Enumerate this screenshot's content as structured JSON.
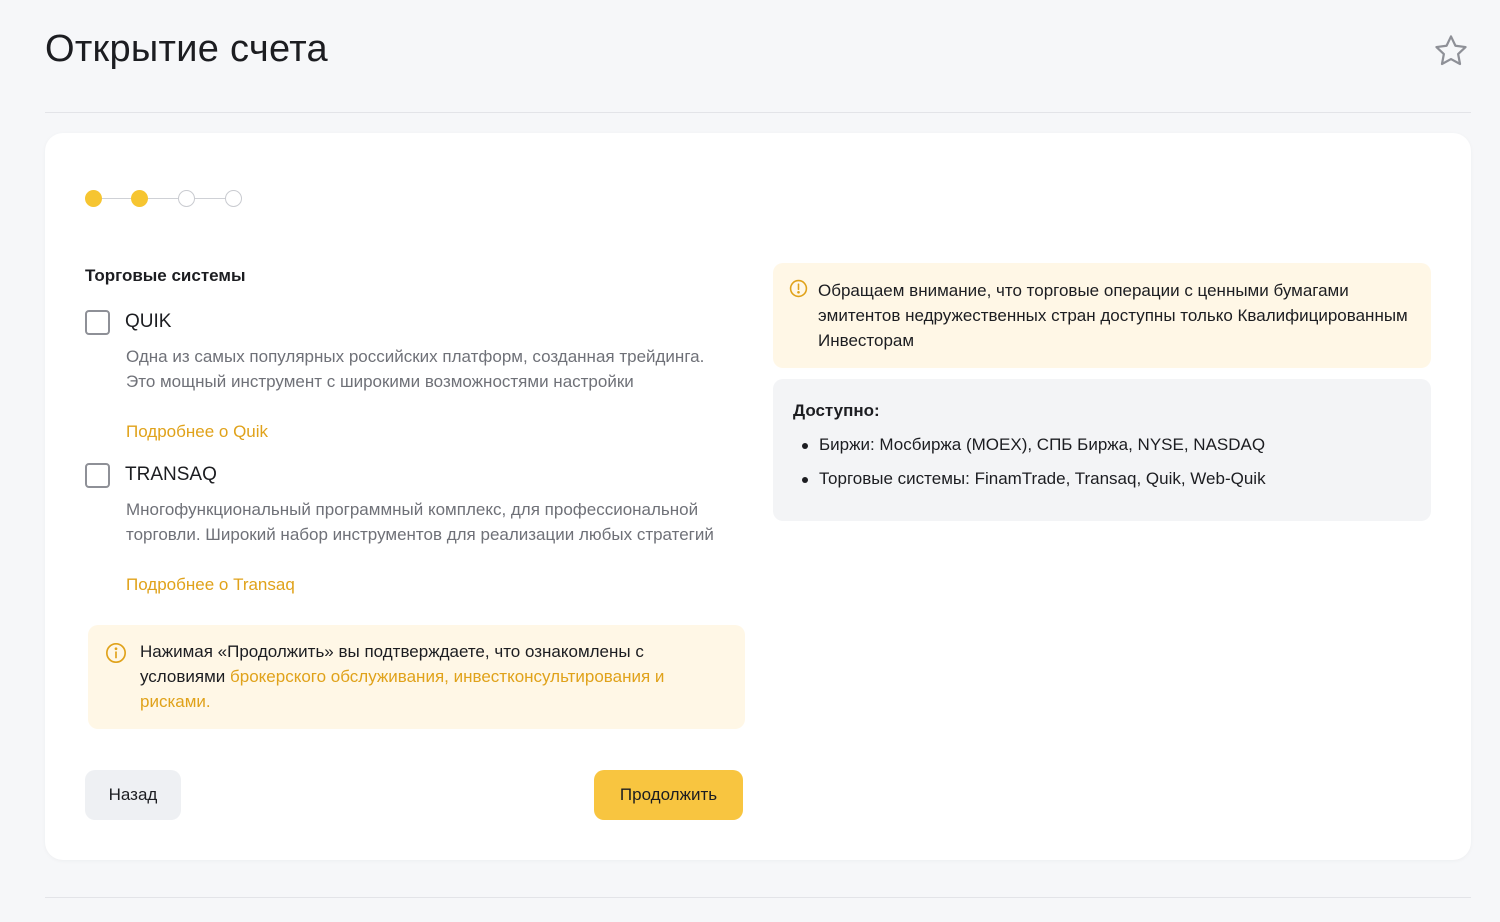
{
  "header": {
    "title": "Открытие счета",
    "favorite_icon": "star-icon"
  },
  "stepper": {
    "total_steps": 4,
    "completed_steps": 2,
    "accent_color": "#f6c531"
  },
  "trading_systems": {
    "title": "Торговые системы",
    "options": [
      {
        "label": "QUIK",
        "checked": false,
        "description": "Одна из самых популярных российских платформ, созданная трейдинга. Это мощный инструмент с широкими возможностями настройки",
        "link_label": "Подробнее о Quik"
      },
      {
        "label": "TRANSAQ",
        "checked": false,
        "description": "Многофункциональный программный комплекс, для профессиональной торговли. Широкий набор инструментов для реализации любых стратегий",
        "link_label": "Подробнее о Transaq"
      }
    ]
  },
  "consent_notice": {
    "text": "Нажимая «Продолжить» вы подтверждаете, что ознакомлены с условиями ",
    "link_text": "брокерского обслуживания, инвестконсультирования и рисками.",
    "icon": "info-icon"
  },
  "buttons": {
    "back_label": "Назад",
    "continue_label": "Продолжить"
  },
  "warning": {
    "icon": "info-icon",
    "text": "Обращаем внимание, что торговые операции с ценными бумагами эмитентов недружественных стран доступны только Квалифицированным Инвесторам"
  },
  "available": {
    "title": "Доступно:",
    "items": [
      "Биржи: Мосбиржа (MOEX), СПБ Биржа, NYSE, NASDAQ",
      "Торговые системы: FinamTrade, Transaq, Quik, Web-Quik"
    ]
  },
  "colors": {
    "accent": "#f6c531",
    "link": "#e0a21a",
    "notice_bg": "#fff7e6"
  }
}
